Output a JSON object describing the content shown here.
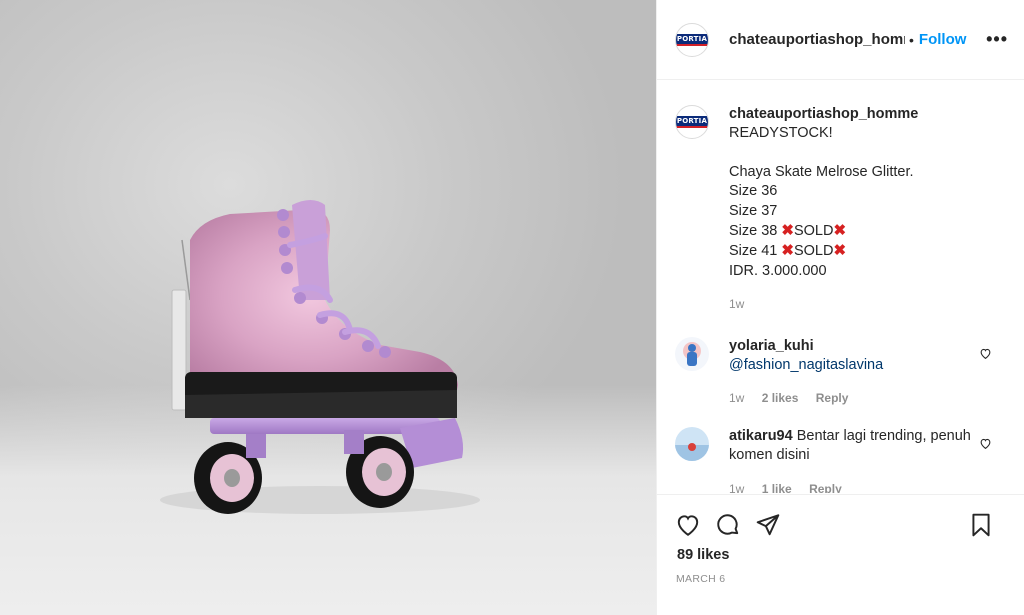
{
  "post": {
    "username": "chateauportiashop_homme",
    "header_username": "chateauportiashop_homm",
    "separator": "•",
    "follow_label": "Follow",
    "more_label": "•••",
    "logo_text": "PORTIA",
    "caption": {
      "line1": "READYSTOCK!",
      "line2": "Chaya Skate Melrose Glitter.",
      "line3": "Size 36",
      "line4": "Size 37",
      "line5_prefix": "Size 38 ",
      "line6_prefix": "Size 41 ",
      "sold_label": "SOLD",
      "x_mark": "✖",
      "line7": "IDR. 3.000.000",
      "age": "1w"
    },
    "comments": [
      {
        "username": "yolaria_kuhi",
        "text": "@fashion_nagitaslavina",
        "age": "1w",
        "likes": "2 likes",
        "reply": "Reply"
      },
      {
        "username": "atikaru94",
        "text": "Bentar lagi trending, penuh komen disini",
        "age": "1w",
        "likes": "1 like",
        "reply": "Reply"
      }
    ],
    "likes_count": "89 likes",
    "date": "MARCH 6"
  },
  "icons": {
    "like": "heart-icon",
    "comment": "comment-icon",
    "share": "paper-plane-icon",
    "save": "bookmark-icon",
    "more": "more-options-icon"
  },
  "colors": {
    "follow": "#0095f6",
    "secondary_text": "#8e8e8e",
    "skate_pink": "#d9a3c4",
    "skate_lilac": "#b892d6",
    "sold_x": "#d62121"
  }
}
